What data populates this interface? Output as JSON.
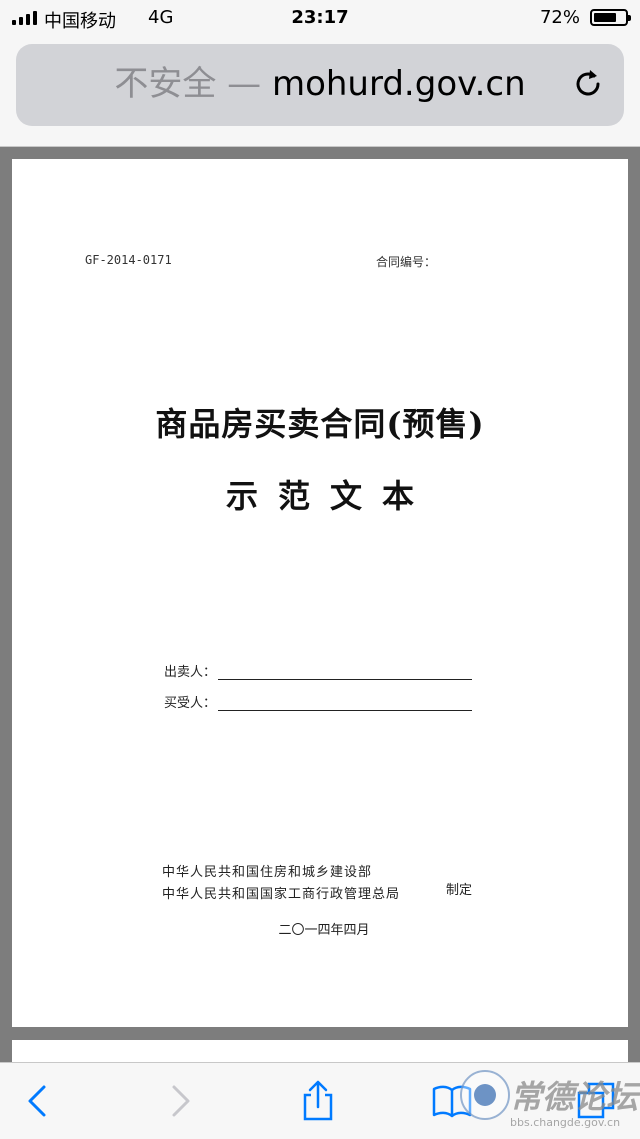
{
  "status_bar": {
    "carrier": "中国移动",
    "network": "4G",
    "time": "23:17",
    "battery_percent": "72%",
    "battery_level": 0.72
  },
  "address_bar": {
    "security_warning": "不安全",
    "separator": " — ",
    "domain": "mohurd.gov.cn"
  },
  "document": {
    "code": "GF-2014-0171",
    "contract_no_label": "合同编号：",
    "title": "商品房买卖合同(预售)",
    "subtitle": "示范文本",
    "seller_label": "出卖人：",
    "buyer_label": "买受人：",
    "issuer_1": "中华人民共和国住房和城乡建设部",
    "issuer_2": "中华人民共和国国家工商行政管理总局",
    "issued_label": "制定",
    "date": "二〇一四年四月"
  },
  "watermark": {
    "title": "常德论坛",
    "url": "bbs.changde.gov.cn"
  },
  "colors": {
    "accent": "#007aff",
    "disabled": "#c7c7cc",
    "viewer_background": "#7d7d7d"
  }
}
